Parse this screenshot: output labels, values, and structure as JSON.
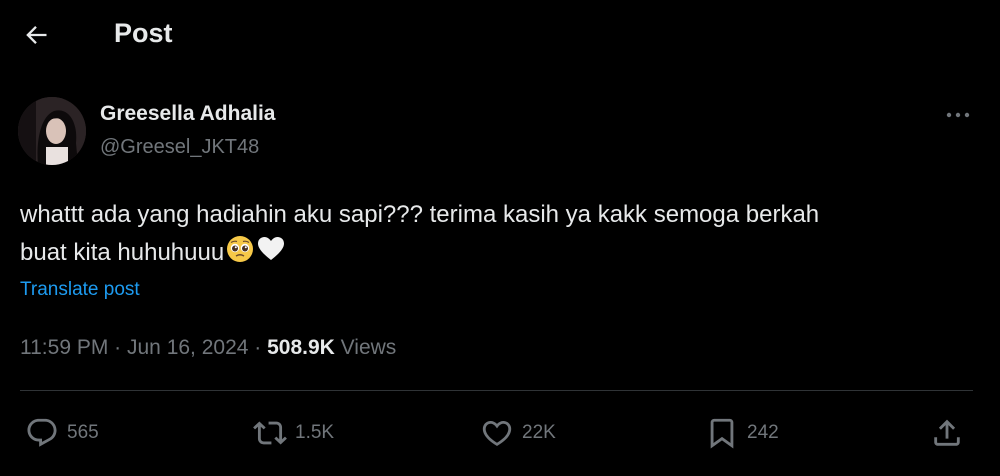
{
  "header": {
    "title": "Post"
  },
  "author": {
    "name": "Greesella Adhalia",
    "handle": "@Greesel_JKT48"
  },
  "tweet": {
    "text_line1": "whattt ada yang hadiahin aku sapi??? terima kasih ya kakk semoga berkah",
    "text_line2": "buat kita huhuhuuu",
    "emojis": [
      "pleading-face-emoji",
      "white-heart-emoji"
    ],
    "translate_label": "Translate post"
  },
  "meta": {
    "time": "11:59 PM",
    "separator": " · ",
    "date": "Jun 16, 2024",
    "views_count": "508.9K",
    "views_label": " Views"
  },
  "actions": {
    "replies": "565",
    "reposts": "1.5K",
    "likes": "22K",
    "bookmarks": "242"
  },
  "colors": {
    "background": "#000000",
    "text": "#e7e9ea",
    "muted": "#71767b",
    "accent": "#1d9bf0",
    "divider": "#2f3336"
  }
}
